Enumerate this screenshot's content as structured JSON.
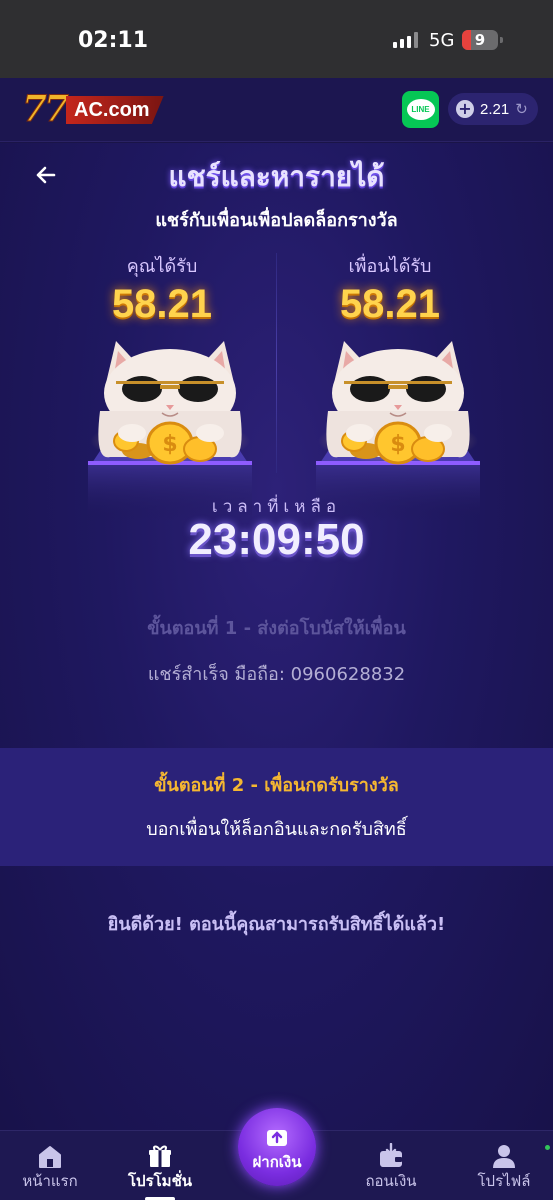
{
  "status_bar": {
    "time": "02:11",
    "network": "5G",
    "battery": "9"
  },
  "header": {
    "logo_num": "77",
    "logo_text": "AC.com",
    "line_label": "LINE",
    "balance": "2.21",
    "icons": {
      "line": "line-app-icon",
      "add": "plus-circle-icon",
      "refresh": "refresh-icon"
    }
  },
  "main": {
    "title": "แชร์และหารายได้",
    "subtitle": "แชร์กับเพื่อนเพื่อปลดล็อกรางวัล",
    "you_receive": {
      "label": "คุณได้รับ",
      "value": "58.21"
    },
    "friend_receives": {
      "label": "เพื่อนได้รับ",
      "value": "58.21"
    },
    "timer_label": "เวลาที่เหลือ",
    "timer_value": "23:09:50",
    "step1": {
      "title": "ขั้นตอนที่ 1 - ส่งต่อโบนัสให้เพื่อน",
      "desc": "แชร์สำเร็จ มือถือ: 0960628832"
    },
    "step2": {
      "title": "ขั้นตอนที่ 2 - เพื่อนกดรับรางวัล",
      "desc": "บอกเพื่อนให้ล็อกอินและกดรับสิทธิ์"
    },
    "congrats": "ยินดีด้วย! ตอนนี้คุณสามารถรับสิทธิ์ได้แล้ว!"
  },
  "bottom_nav": {
    "items": [
      {
        "label": "หน้าแรก",
        "icon": "home-icon"
      },
      {
        "label": "โปรโมชั่น",
        "icon": "gift-icon"
      },
      {
        "label": "ฝากเงิน",
        "icon": "deposit-icon"
      },
      {
        "label": "ถอนเงิน",
        "icon": "wallet-icon"
      },
      {
        "label": "โปรไฟล์",
        "icon": "user-icon"
      }
    ],
    "active_index": 1
  },
  "colors": {
    "background": "#1a1448",
    "gold": "#ffd34d",
    "step2_title": "#f5b731",
    "step2_bg": "#2b2279",
    "line_green": "#06c755",
    "deposit_purple": "#7a2de0"
  }
}
